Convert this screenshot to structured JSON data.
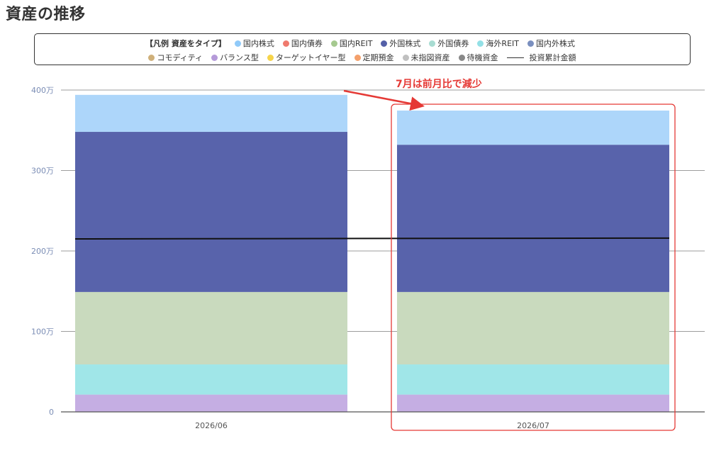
{
  "page": {
    "title": "資産の推移"
  },
  "legend": {
    "heading": "【凡例 資産をタイプ】",
    "row1": [
      {
        "name": "domestic-stock",
        "label": "国内株式",
        "color": "#90caf9"
      },
      {
        "name": "domestic-bond",
        "label": "国内債券",
        "color": "#ef7a6e"
      },
      {
        "name": "domestic-reit",
        "label": "国内REIT",
        "color": "#a5c98f"
      },
      {
        "name": "foreign-stock",
        "label": "外国株式",
        "color": "#5460a8"
      },
      {
        "name": "foreign-bond",
        "label": "外国債券",
        "color": "#a8dcd2"
      },
      {
        "name": "overseas-reit",
        "label": "海外REIT",
        "color": "#93e0e6"
      },
      {
        "name": "domestic-foreign-stock",
        "label": "国内外株式",
        "color": "#7a8fbf"
      }
    ],
    "row2": [
      {
        "name": "commodity",
        "label": "コモディティ",
        "color": "#cfb07a"
      },
      {
        "name": "balanced",
        "label": "バランス型",
        "color": "#b59ad9"
      },
      {
        "name": "target-year",
        "label": "ターゲットイヤー型",
        "color": "#f6d44a"
      },
      {
        "name": "time-deposit",
        "label": "定期預金",
        "color": "#f4a06b"
      },
      {
        "name": "unspecified",
        "label": "未指図資産",
        "color": "#c0c0c0"
      },
      {
        "name": "standby-funds",
        "label": "待機資金",
        "color": "#888888"
      }
    ],
    "line_label": "投資累計金額"
  },
  "chart_data": {
    "type": "bar",
    "stacked": true,
    "categories": [
      "2026/06",
      "2026/07"
    ],
    "ylim": [
      0,
      4000000
    ],
    "y_ticks": [
      {
        "value": 0,
        "label": "0"
      },
      {
        "value": 1000000,
        "label": "100万"
      },
      {
        "value": 2000000,
        "label": "200万"
      },
      {
        "value": 3000000,
        "label": "300万"
      },
      {
        "value": 4000000,
        "label": "400万"
      }
    ],
    "grid": true,
    "series": [
      {
        "name": "バランス型",
        "color": "#c5aee3",
        "values": [
          215000,
          215000
        ]
      },
      {
        "name": "海外REIT",
        "color": "#a0e6e8",
        "values": [
          375000,
          375000
        ]
      },
      {
        "name": "国内REIT",
        "color": "#c9dabe",
        "values": [
          900000,
          900000
        ]
      },
      {
        "name": "外国株式",
        "color": "#5863ab",
        "values": [
          1990000,
          1830000
        ]
      },
      {
        "name": "国内株式",
        "color": "#add6fa",
        "values": [
          460000,
          425000
        ]
      }
    ],
    "line_series": {
      "name": "投資累計金額",
      "color": "#111111",
      "values": [
        2150000,
        2160000
      ]
    },
    "annotation": {
      "text": "7月は前月比で減少",
      "color": "#e53935",
      "target": "2026/07"
    }
  }
}
